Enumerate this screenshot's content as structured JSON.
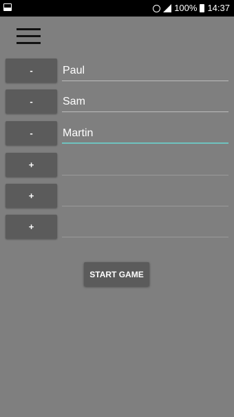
{
  "status_bar": {
    "battery_percent": "100%",
    "time": "14:37"
  },
  "menu": {
    "icon": "hamburger-menu-icon"
  },
  "players": [
    {
      "button_label": "-",
      "name": "Paul"
    },
    {
      "button_label": "-",
      "name": "Sam"
    },
    {
      "button_label": "-",
      "name": "Martin"
    },
    {
      "button_label": "+",
      "name": ""
    },
    {
      "button_label": "+",
      "name": ""
    },
    {
      "button_label": "+",
      "name": ""
    }
  ],
  "focused_player_index": 2,
  "start_button": {
    "label": "START GAME"
  },
  "colors": {
    "background": "#7f7f7f",
    "button": "#5b5b5b",
    "accent": "#6fc3c0",
    "status_bar": "#000000"
  }
}
